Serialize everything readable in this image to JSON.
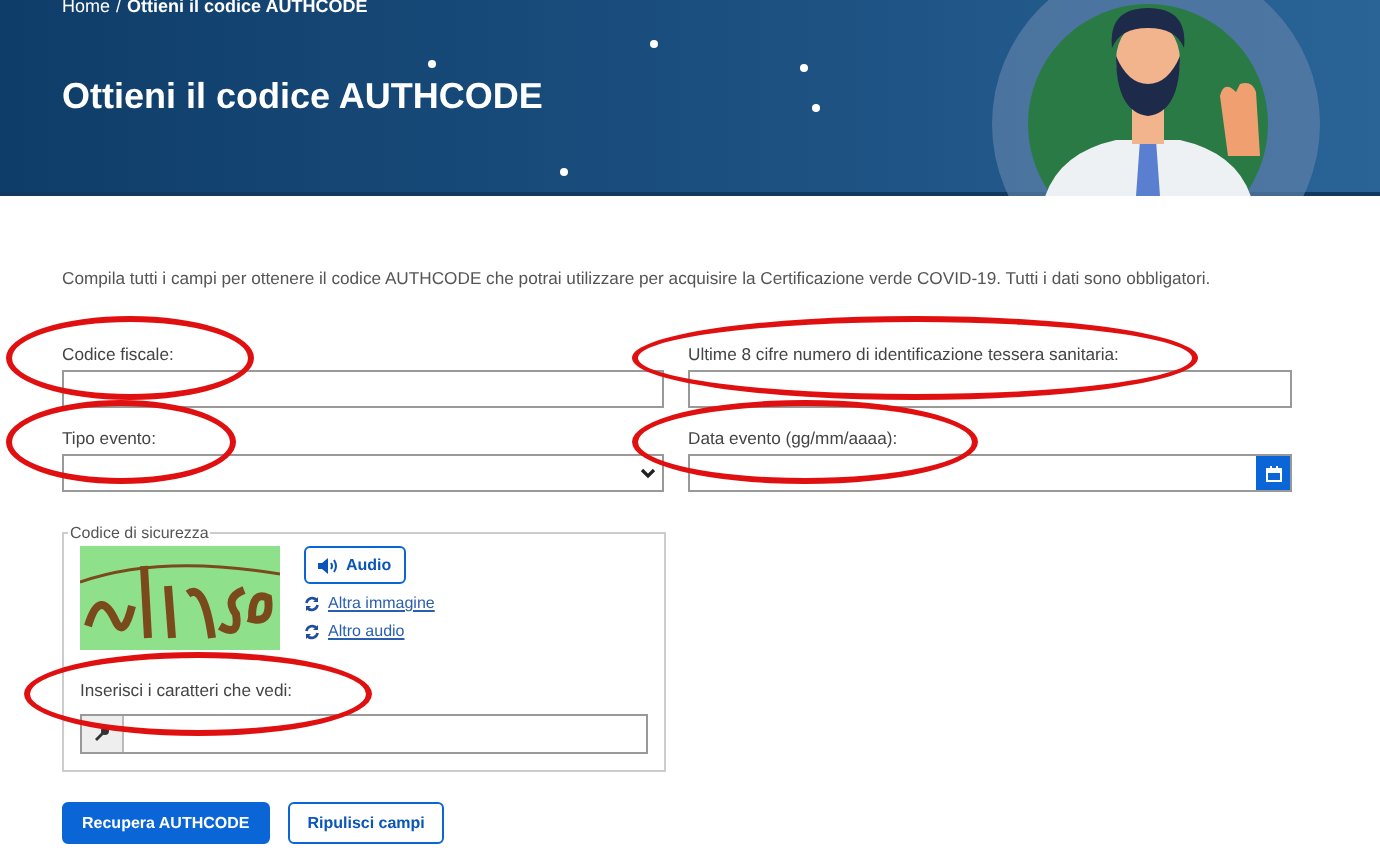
{
  "breadcrumb": [
    {
      "label": "Home",
      "current": false
    },
    {
      "label": "Ottieni il codice AUTHCODE",
      "current": true
    }
  ],
  "breadcrumb_separator": "/",
  "title": "Ottieni il codice AUTHCODE",
  "intro": "Compila tutti i campi per ottenere il codice AUTHCODE che potrai utilizzare per acquisire la Certificazione verde COVID-19. Tutti i dati sono obbligatori.",
  "fields": [
    {
      "label": "Codice fiscale:",
      "kind": "text",
      "circled": true
    },
    {
      "label": "Ultime 8 cifre numero di identificazione tessera sanitaria:",
      "kind": "text",
      "circled": true
    },
    {
      "label": "Tipo evento:",
      "kind": "select",
      "circled": true
    },
    {
      "label": "Data evento (gg/mm/aaaa):",
      "kind": "date",
      "circled": true
    }
  ],
  "security": {
    "legend": "Codice di sicurezza",
    "audio_button": "Audio",
    "links": [
      "Altra immagine",
      "Altro audio"
    ],
    "input_label": "Inserisci i caratteri che vedi:",
    "input_circled": true
  },
  "buttons": [
    {
      "label": "Recupera AUTHCODE",
      "kind": "primary"
    },
    {
      "label": "Ripulisci campi",
      "kind": "secondary"
    }
  ]
}
